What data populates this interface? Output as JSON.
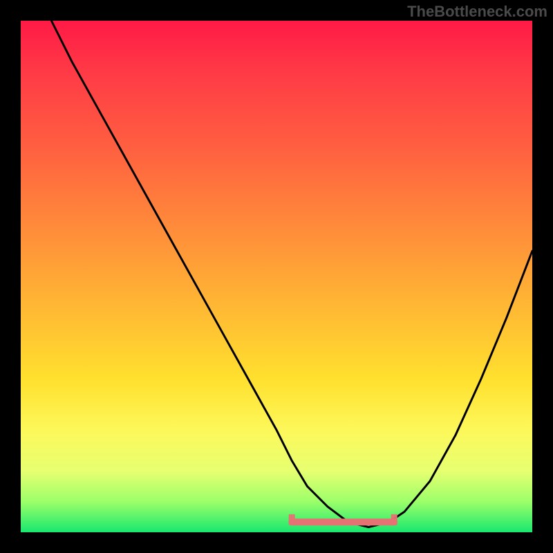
{
  "watermark": "TheBottleneck.com",
  "colors": {
    "background": "#000000",
    "gradient_top": "#ff1a46",
    "gradient_mid": "#ffe02e",
    "gradient_bottom": "#18e86e",
    "curve": "#000000",
    "bottom_marker": "#e57373"
  },
  "chart_data": {
    "type": "line",
    "title": "",
    "xlabel": "",
    "ylabel": "",
    "xlim": [
      0,
      100
    ],
    "ylim": [
      0,
      100
    ],
    "series": [
      {
        "name": "bottleneck-curve",
        "x": [
          6,
          10,
          15,
          20,
          25,
          30,
          35,
          40,
          45,
          50,
          53,
          56,
          60,
          64,
          68,
          72,
          75,
          80,
          85,
          90,
          95,
          100
        ],
        "values": [
          100,
          92,
          83,
          74,
          65,
          56,
          47,
          38,
          29,
          20,
          14,
          9,
          5,
          2,
          1,
          2,
          4,
          10,
          19,
          30,
          42,
          55
        ]
      }
    ],
    "annotations": [
      {
        "name": "flat-bottom-band",
        "x_start": 53,
        "x_end": 73,
        "y": 2
      }
    ],
    "grid": false,
    "legend": false
  }
}
